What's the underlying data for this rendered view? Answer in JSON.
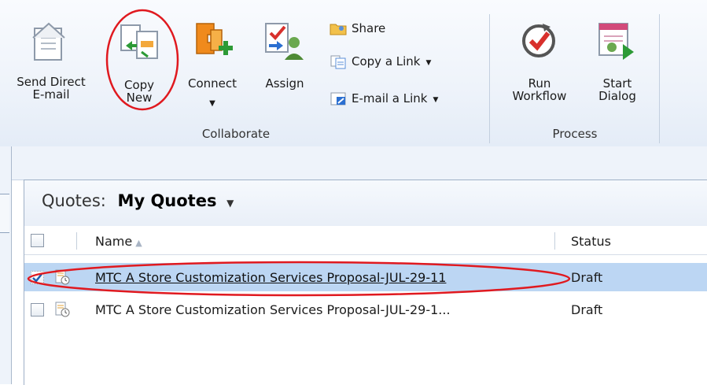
{
  "ribbon": {
    "collaborate": {
      "label": "Collaborate",
      "send_direct_email": {
        "line1": "Send Direct",
        "line2": "E-mail"
      },
      "copy_new": {
        "line1": "Copy",
        "line2": "New"
      },
      "connect": {
        "line1": "Connect"
      },
      "assign": {
        "line1": "Assign"
      },
      "share": "Share",
      "copy_link": "Copy a Link",
      "email_link": "E-mail a Link"
    },
    "process": {
      "label": "Process",
      "run_workflow": {
        "line1": "Run",
        "line2": "Workflow"
      },
      "start_dialog": {
        "line1": "Start",
        "line2": "Dialog"
      }
    }
  },
  "view": {
    "entity_label": "Quotes:",
    "view_name": "My Quotes",
    "columns": {
      "name": "Name",
      "status": "Status"
    }
  },
  "rows": [
    {
      "name": "MTC A Store Customization Services Proposal-JUL-29-11",
      "status": "Draft",
      "selected": true
    },
    {
      "name": "MTC A Store Customization Services Proposal-JUL-29-1...",
      "status": "Draft",
      "selected": false
    }
  ],
  "colors": {
    "annotation_red": "#e0191f",
    "selection_blue": "#bcd6f3",
    "ribbon_bg": "#eef3fa"
  },
  "icons": {
    "send_direct_email": "envelope-document-icon",
    "copy_new": "copy-documents-arrows-icon",
    "connect": "connect-puzzle-plus-icon",
    "assign": "assign-checklist-person-icon",
    "share": "share-folder-icon",
    "copy_link": "copy-link-icon",
    "email_link": "email-link-icon",
    "run_workflow": "run-workflow-check-icon",
    "start_dialog": "start-dialog-play-icon",
    "quote_record": "quote-document-clock-icon"
  }
}
